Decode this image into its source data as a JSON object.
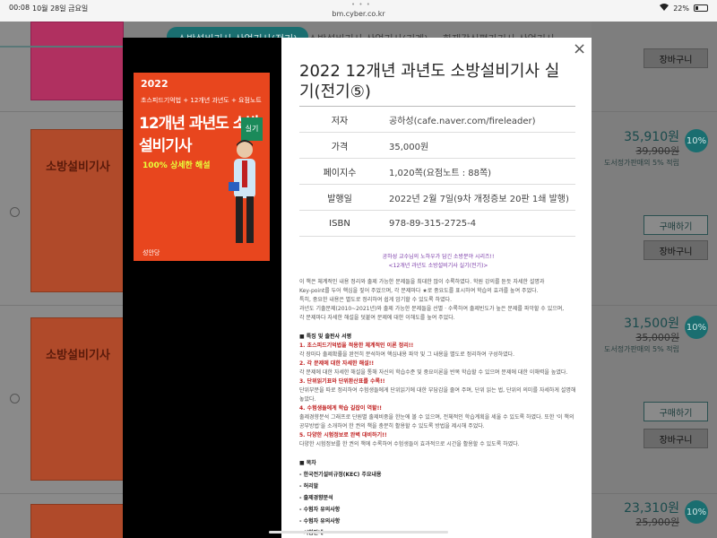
{
  "status_bar": {
    "time": "00:08",
    "date": "10월 28일 금요일",
    "url": "bm.cyber.co.kr",
    "battery": "22%"
  },
  "tabs": [
    {
      "label": "소방설비기사·산업기사(전기)",
      "active": true
    },
    {
      "label": "소방설비기사·산업기사(기계)",
      "active": false
    },
    {
      "label": "화재감식평가기사·산업기사",
      "active": false
    }
  ],
  "products": [
    {
      "cart": "장바구니"
    },
    {
      "price": "35,910원",
      "original": "39,900원",
      "discount": "10%",
      "note": "도서정가판매의 5% 적립",
      "buy": "구매하기",
      "cart": "장바구니"
    },
    {
      "price": "31,500원",
      "original": "35,000원",
      "discount": "10%",
      "note": "도서정가판매의 5% 적립",
      "buy": "구매하기",
      "cart": "장바구니"
    },
    {
      "price": "23,310원",
      "original": "25,900원",
      "discount": "10%"
    }
  ],
  "card_titles": [
    "소방설비기사",
    "소방설비기사"
  ],
  "cover": {
    "year": "2022",
    "subtitle": "초스피드기억법 + 12개년 과년도 + 요점노트",
    "title": "12개년 과년도 소방설비기사",
    "badge": "실기",
    "highlight": "100% 상세한 해설",
    "publisher": "성안당"
  },
  "modal": {
    "close": "×",
    "title": "2022 12개년 과년도 소방설비기사 실기(전기⑤)",
    "info": [
      {
        "label": "저자",
        "value": "공하성(cafe.naver.com/fireleader)"
      },
      {
        "label": "가격",
        "value": "35,000원"
      },
      {
        "label": "페이지수",
        "value": "1,020쪽(요점노트 : 88쪽)"
      },
      {
        "label": "발행일",
        "value": "2022년 2월 7일(9차 개정증보 20판 1쇄 발행)"
      },
      {
        "label": "ISBN",
        "value": "978-89-315-2725-4"
      }
    ],
    "desc_center1": "공하성 교수님의 노하우가 담긴 소방분야 시리즈!!",
    "desc_center2": "<12개년 과년도 소방설비기사 실기(전기)>",
    "desc_intro": [
      "이 책은 체계적인 내용 정리와 출제 가능한 문제들을 최대한 많이 수록하였다. 학원 강의를 듣듯 자세한 설명과",
      "Key-point를 두어 핵심을 짚어 주었으며, 각 문제마다 ★로 중요도를 표시하여 학습의 효과를 높여 주었다.",
      "특히, 중요한 내용은 별도로 정리하여 쉽게 암기할 수 있도록 하였다.",
      "과년도 기출문제(2010~2021년)와 출제 가능한 문제들을 선별 · 수록하여 출제빈도가 높은 문제를 파악할 수 있으며,",
      "각 문제마다 자세한 해설을 덧붙여 문제에 대한 이해도를 높여 주었다."
    ],
    "features_heading": "■ 특징 및 출판사 서평",
    "features": [
      {
        "title": "1. 초스피드기억법을 적용한 체계적인 이론 정리!!",
        "text": "각 장마다 출제확률을 완전히 분석하여 핵심내용 파악 및 그 내용을 별도로 정리하여 구성하였다."
      },
      {
        "title": "2. 각 문제에 대한 자세한 해설!!",
        "text": "각 문제에 대한 자세한 해설을 통해 자신의 학습수준 및 중요이론을 반복 학습할 수 있으며 문제에 대한 이해력을 높였다."
      },
      {
        "title": "3. 단위읽기표와 단위환산표를 수록!!",
        "text": "단위부분을 따로 정리하여 수험생들에게 단위읽기에 대한 부담감을 줄여 주며, 단위 읽는 법, 단위의 의미를 자세하게 설명해 놓았다."
      },
      {
        "title": "4. 수험생들에게 학습 길잡이 역할!!",
        "text": "출제경향분석 그래프로 단원별 출제비중을 한눈에 볼 수 있으며, 전체적인 학습계획을 세울 수 있도록 하였다. 또한 '이 책의 공부방법'을 소개하여 한 권의 책을 충분히 활용할 수 있도록 방법을 제시해 주었다."
      },
      {
        "title": "5. 다양한 시험정보로 완벽 대비하기!!",
        "text": "다양한 시험정보를 한 권의 책에 수록하여 수험생들이 효과적으로 시간을 활용할 수 있도록 하였다."
      }
    ],
    "toc_heading": "■ 목차",
    "toc": [
      "- 한국전기설비규정(KEC) 주요내용",
      "- 허리말",
      "- 출제경향분석",
      "- 수험자 유의사항",
      "- 수험자 유의사항",
      "- 시험안내"
    ]
  }
}
